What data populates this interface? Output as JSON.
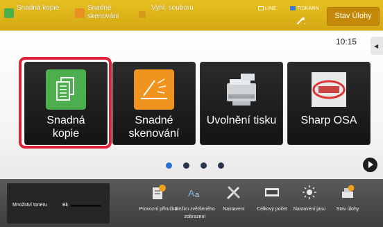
{
  "topbar": {
    "shortcuts": [
      {
        "label": "Snadná kopie",
        "color": "#4bb04b"
      },
      {
        "label": "Snadné skenování",
        "color": "#e89122"
      },
      {
        "label": "Vyhl. souboru",
        "color": "#d69a1a"
      }
    ],
    "status_line": "LINE",
    "status_print": "TISKÁRN",
    "job_status_button": "Stav Úlohy"
  },
  "clock": "10:15",
  "tiles": [
    {
      "label": "Snadná kopie",
      "selected": true,
      "icon": "copy-icon"
    },
    {
      "label": "Snadné skenování",
      "selected": false,
      "icon": "scan-icon"
    },
    {
      "label": "Uvolnění tisku",
      "selected": false,
      "icon": "printer-icon"
    },
    {
      "label": "Sharp OSA",
      "selected": false,
      "icon": "sharp-osa-icon"
    }
  ],
  "pager": {
    "pages": 4,
    "current": 1
  },
  "bottombar": {
    "toner_label": "Množství toneru",
    "toner_color": "Bk",
    "items": [
      {
        "label": "Provozní příručka",
        "icon": "manual-icon"
      },
      {
        "label": "Režim zvětšeného zobrazení",
        "icon": "enlarge-display-icon"
      },
      {
        "label": "Nastavení",
        "icon": "settings-icon"
      },
      {
        "label": "Celkový počet",
        "icon": "counter-icon"
      },
      {
        "label": "Nastavení jasu",
        "icon": "brightness-icon"
      },
      {
        "label": "Stav úlohy",
        "icon": "job-status-icon"
      }
    ]
  }
}
